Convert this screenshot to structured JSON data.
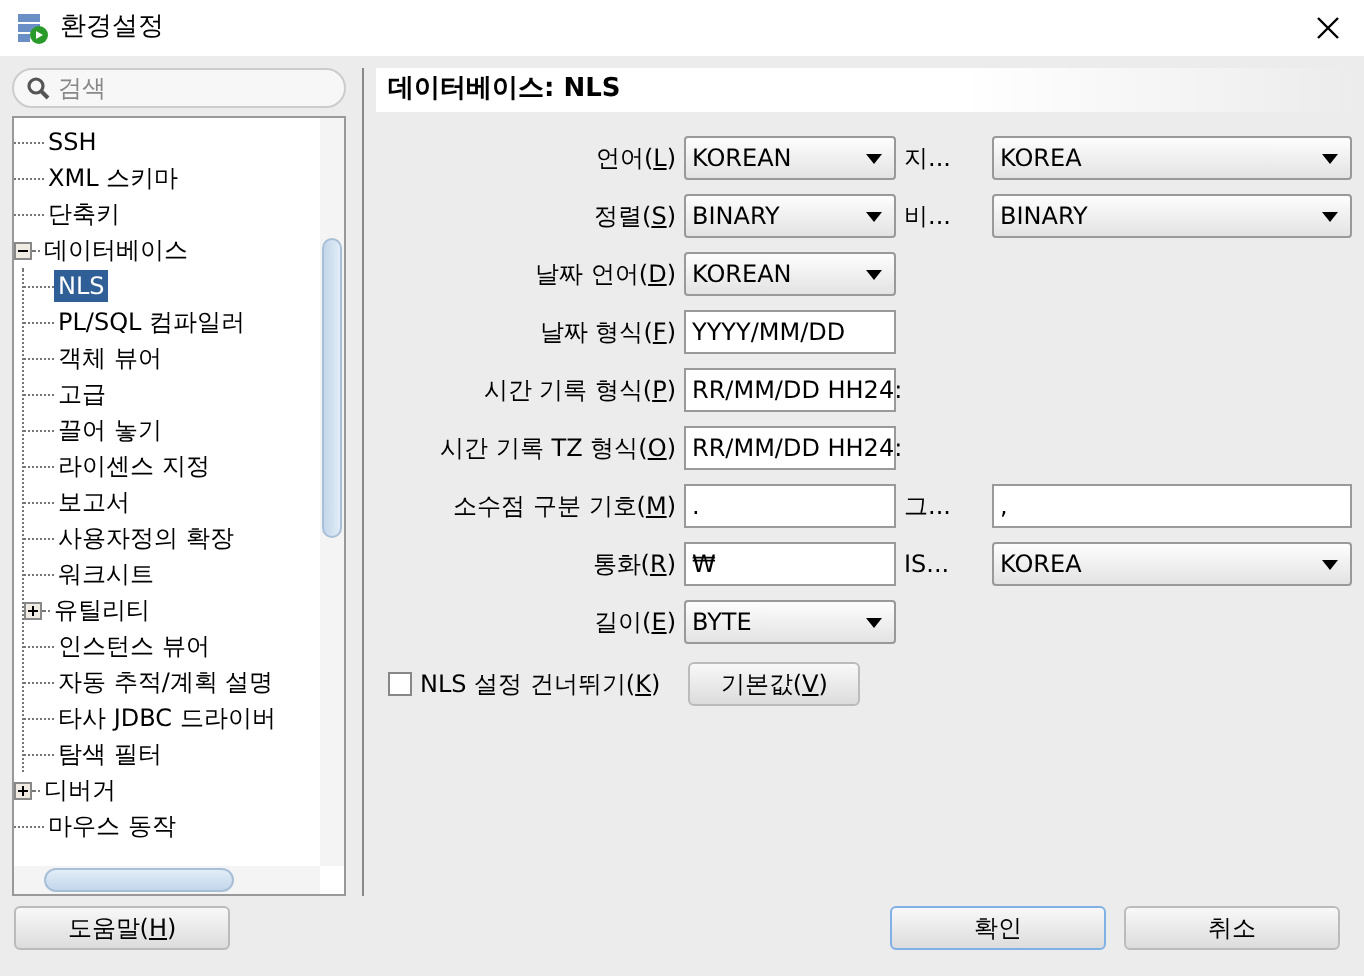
{
  "window": {
    "title": "환경설정"
  },
  "search": {
    "placeholder": "검색"
  },
  "tree": [
    {
      "label": "SSH",
      "selected": false
    },
    {
      "label": "XML 스키마",
      "selected": false
    },
    {
      "label": "단축키",
      "selected": false
    },
    {
      "label": "데이터베이스",
      "selected": false,
      "expanded": true,
      "children": [
        {
          "label": "NLS",
          "selected": true
        },
        {
          "label": "PL/SQL 컴파일러",
          "selected": false
        },
        {
          "label": "객체 뷰어",
          "selected": false
        },
        {
          "label": "고급",
          "selected": false
        },
        {
          "label": "끌어 놓기",
          "selected": false
        },
        {
          "label": "라이센스 지정",
          "selected": false
        },
        {
          "label": "보고서",
          "selected": false
        },
        {
          "label": "사용자정의 확장",
          "selected": false
        },
        {
          "label": "워크시트",
          "selected": false
        },
        {
          "label": "유틸리티",
          "selected": false,
          "expanded": false
        },
        {
          "label": "인스턴스 뷰어",
          "selected": false
        },
        {
          "label": "자동 추적/계획 설명",
          "selected": false
        },
        {
          "label": "타사 JDBC 드라이버",
          "selected": false
        },
        {
          "label": "탐색 필터",
          "selected": false
        }
      ]
    },
    {
      "label": "디버거",
      "selected": false,
      "expanded": false
    },
    {
      "label": "마우스 동작",
      "selected": false
    }
  ],
  "help_button": "도움말(H)",
  "panel": {
    "title": "데이터베이스: NLS",
    "rows": [
      {
        "label": "언어(L)",
        "control": {
          "kind": "select",
          "value": "KOREAN"
        },
        "second": {
          "label": "지...",
          "control": {
            "kind": "select",
            "value": "KOREA"
          }
        }
      },
      {
        "label": "정렬(S)",
        "control": {
          "kind": "select",
          "value": "BINARY"
        },
        "second": {
          "label": "비...",
          "control": {
            "kind": "select",
            "value": "BINARY"
          }
        }
      },
      {
        "label": "날짜 언어(D)",
        "control": {
          "kind": "select",
          "value": "KOREAN"
        }
      },
      {
        "label": "날짜 형식(F)",
        "control": {
          "kind": "text",
          "value": "YYYY/MM/DD"
        }
      },
      {
        "label": "시간 기록 형식(P)",
        "control": {
          "kind": "text",
          "value": "RR/MM/DD HH24:"
        }
      },
      {
        "label": "시간 기록 TZ 형식(O)",
        "control": {
          "kind": "text",
          "value": "RR/MM/DD HH24:"
        }
      },
      {
        "label": "소수점 구분 기호(M)",
        "control": {
          "kind": "text",
          "value": "."
        },
        "second": {
          "label": "그...",
          "control": {
            "kind": "text",
            "value": ","
          }
        }
      },
      {
        "label": "통화(R)",
        "control": {
          "kind": "text",
          "value": "₩"
        },
        "second": {
          "label": "IS...",
          "control": {
            "kind": "select",
            "value": "KOREA"
          }
        }
      },
      {
        "label": "길이(E)",
        "control": {
          "kind": "select",
          "value": "BYTE"
        }
      }
    ],
    "skip_checkbox": {
      "label": "NLS 설정 건너뛰기(K)",
      "checked": false
    },
    "defaults_button": "기본값(V)"
  },
  "footer": [
    {
      "label": "확인",
      "default": true
    },
    {
      "label": "취소",
      "default": false
    }
  ]
}
